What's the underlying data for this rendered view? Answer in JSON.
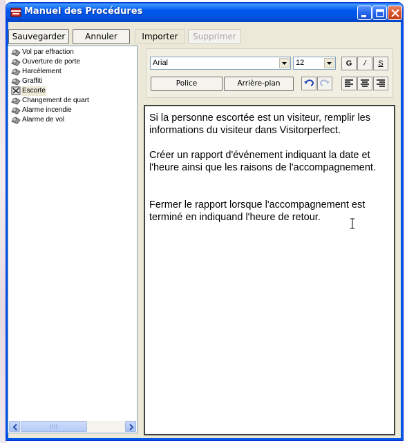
{
  "window": {
    "title": "Manuel des Procédures"
  },
  "toolbar": {
    "save": "Sauvegarder",
    "cancel": "Annuler",
    "import": "Importer",
    "delete": "Supprimer"
  },
  "tree": {
    "items": [
      {
        "label": "Vol par effraction",
        "icon": "procedure-icon"
      },
      {
        "label": "Ouverture de porte",
        "icon": "procedure-icon"
      },
      {
        "label": "Harcèlement",
        "icon": "procedure-icon"
      },
      {
        "label": "Graffiti",
        "icon": "procedure-icon"
      },
      {
        "label": "Escorte",
        "icon": "escort-icon",
        "selected": true
      },
      {
        "label": "Changement de quart",
        "icon": "procedure-icon"
      },
      {
        "label": "Alarme incendie",
        "icon": "procedure-icon"
      },
      {
        "label": "Alarme de vol",
        "icon": "procedure-icon"
      }
    ]
  },
  "format": {
    "font": "Arial",
    "size": "12",
    "bold": "G",
    "italic": "/",
    "underline": "S",
    "font_button": "Police",
    "background_button": "Arrière-plan"
  },
  "editor": {
    "paragraphs": [
      "Si la personne escortée est un visiteur, remplir les informations du visiteur dans Visitorperfect.",
      "Créer un rapport d'événement indiquant la date et l'heure ainsi que les raisons de l'accompagnement.",
      "Fermer le rapport lorsque l'accompagnement est terminé en indiquand l'heure de retour."
    ]
  },
  "colors": {
    "titlebar": "#0055e5",
    "window_bg": "#ece9d8",
    "close": "#d9522c"
  }
}
